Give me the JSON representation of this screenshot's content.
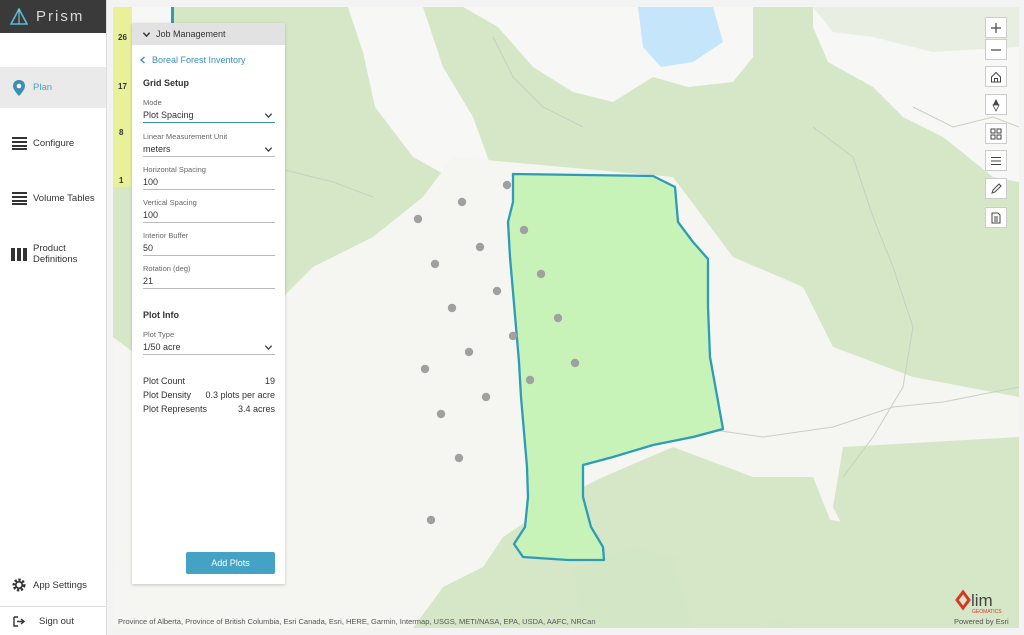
{
  "app": {
    "name": "Prism"
  },
  "nav": {
    "plan": "Plan",
    "configure": "Configure",
    "volume_tables": "Volume Tables",
    "product_definitions_line1": "Product",
    "product_definitions_line2": "Definitions",
    "app_settings": "App Settings",
    "sign_out": "Sign out"
  },
  "strip": {
    "numbers": [
      "26",
      "17",
      "8",
      "1"
    ]
  },
  "panel": {
    "header": "Job Management",
    "back_link": "Boreal Forest Inventory",
    "grid_setup": {
      "title": "Grid Setup",
      "mode_label": "Mode",
      "mode_value": "Plot Spacing",
      "unit_label": "Linear Measurement Unit",
      "unit_value": "meters",
      "h_spacing_label": "Horizontal Spacing",
      "h_spacing_value": "100",
      "v_spacing_label": "Vertical Spacing",
      "v_spacing_value": "100",
      "buffer_label": "Interior Buffer",
      "buffer_value": "50",
      "rotation_label": "Rotation (deg)",
      "rotation_value": "21"
    },
    "plot_info": {
      "title": "Plot Info",
      "type_label": "Plot Type",
      "type_value": "1/50 acre"
    },
    "stats": {
      "count_label": "Plot Count",
      "count_value": "19",
      "density_label": "Plot Density",
      "density_value": "0.3 plots per acre",
      "represents_label": "Plot Represents",
      "represents_value": "3.4 acres"
    },
    "add_button": "Add Plots"
  },
  "map": {
    "attribution": "Province of Alberta, Province of British Columbia, Esri Canada, Esri, HERE, Garmin, Intermap, USGS, METI/NASA, EPA, USDA, AAFC, NRCan",
    "powered_by": "Powered by Esri",
    "logo_text": "lim",
    "logo_subtext": "GEOMATICS",
    "colors": {
      "polygon_fill": "#c8f3b8",
      "polygon_stroke": "#2e9bb7",
      "plot_dot": "#a0a0a0",
      "water": "#c5e6fa",
      "forest": "#d4e6c4",
      "accent": "#44a3c4"
    }
  }
}
